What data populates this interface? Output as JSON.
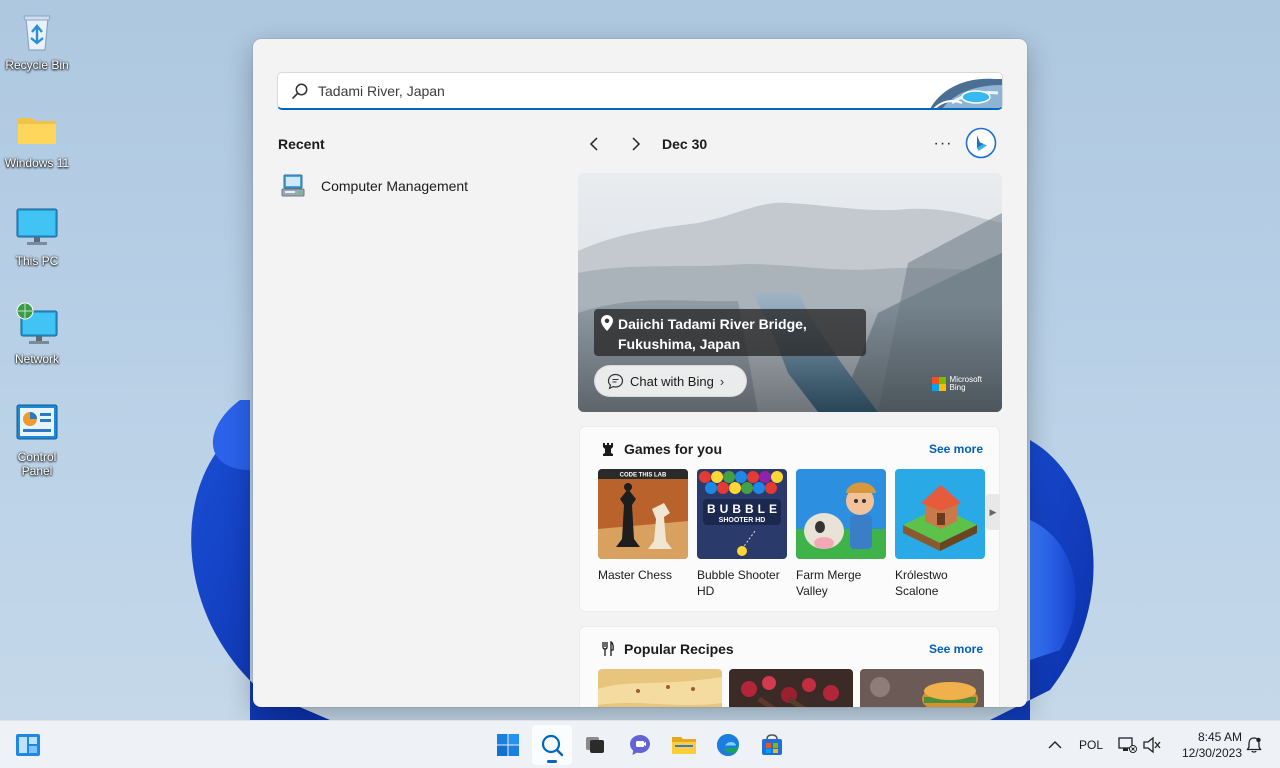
{
  "desktop": {
    "icons": [
      {
        "label": "Recycle Bin",
        "icon": "recycle-bin-icon"
      },
      {
        "label": "Windows 11",
        "icon": "folder-icon"
      },
      {
        "label": "This PC",
        "icon": "monitor-icon"
      },
      {
        "label": "Network",
        "icon": "network-icon"
      },
      {
        "label": "Control Panel",
        "icon": "control-panel-icon"
      }
    ]
  },
  "search": {
    "query": "Tadami River, Japan",
    "recent_heading": "Recent",
    "recent_items": [
      {
        "label": "Computer Management",
        "icon": "computer-management-icon"
      }
    ],
    "date_label": "Dec 30",
    "more_label": "···",
    "hero": {
      "location_line1": "Daiichi Tadami River Bridge,",
      "location_line2": "Fukushima, Japan",
      "chat_label": "Chat with Bing",
      "brand_line1": "Microsoft",
      "brand_line2": "Bing"
    },
    "games": {
      "heading": "Games for you",
      "see_more": "See more",
      "items": [
        {
          "name": "Master Chess",
          "tile_text": "CODE THIS LAB"
        },
        {
          "name": "Bubble Shooter HD",
          "tile_text": "BUBBLE SHOOTER HD"
        },
        {
          "name": "Farm Merge Valley",
          "tile_text": ""
        },
        {
          "name": "Królestwo Scalone",
          "tile_text": ""
        }
      ]
    },
    "recipes": {
      "heading": "Popular Recipes",
      "see_more": "See more"
    }
  },
  "taskbar": {
    "language": "POL",
    "time": "8:45 AM",
    "date": "12/30/2023",
    "apps": [
      "start-icon",
      "search-icon",
      "task-view-icon",
      "chat-icon",
      "file-explorer-icon",
      "edge-icon",
      "store-icon"
    ]
  },
  "colors": {
    "accent": "#0067c0",
    "link": "#005fb8",
    "flyout_bg": "#f3f3f3"
  }
}
